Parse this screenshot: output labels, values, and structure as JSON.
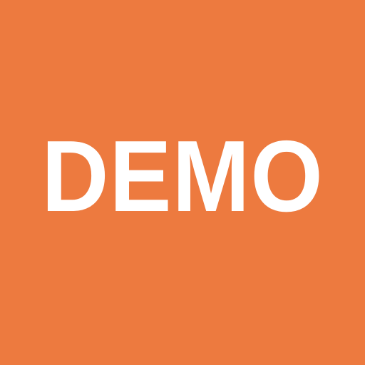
{
  "label": {
    "text": "DEMO"
  },
  "colors": {
    "background": "#ED7A3F",
    "text": "#FFFFFF"
  }
}
